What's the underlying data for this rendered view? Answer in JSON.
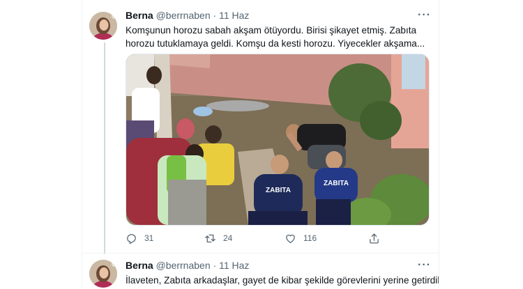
{
  "tweets": [
    {
      "author": "Berna",
      "handle": "@berrnaben",
      "separator": "·",
      "date": "11 Haz",
      "text": "Komşunun horozu sabah akşam ötüyordu. Birisi şikayet etmiş. Zabıta horozu tutuklamaya geldi. Komşu da kesti horozu. Yiyecekler akşama...",
      "media": {
        "badge_left": "ZABITA",
        "badge_right": "ZABITA"
      },
      "actions": {
        "reply": {
          "icon": "reply-icon",
          "count": "31"
        },
        "retweet": {
          "icon": "retweet-icon",
          "count": "24"
        },
        "like": {
          "icon": "heart-icon",
          "count": "116"
        },
        "share": {
          "icon": "share-icon"
        }
      }
    },
    {
      "author": "Berna",
      "handle": "@berrnaben",
      "separator": "·",
      "date": "11 Haz",
      "text": "İlaveten, Zabıta arkadaşlar, gayet de kibar şekilde görevlerini yerine getirdiler"
    }
  ],
  "more_label": "···",
  "colors": {
    "text": "#0f1419",
    "secondary": "#536471",
    "thread_line": "#cfd9de"
  }
}
